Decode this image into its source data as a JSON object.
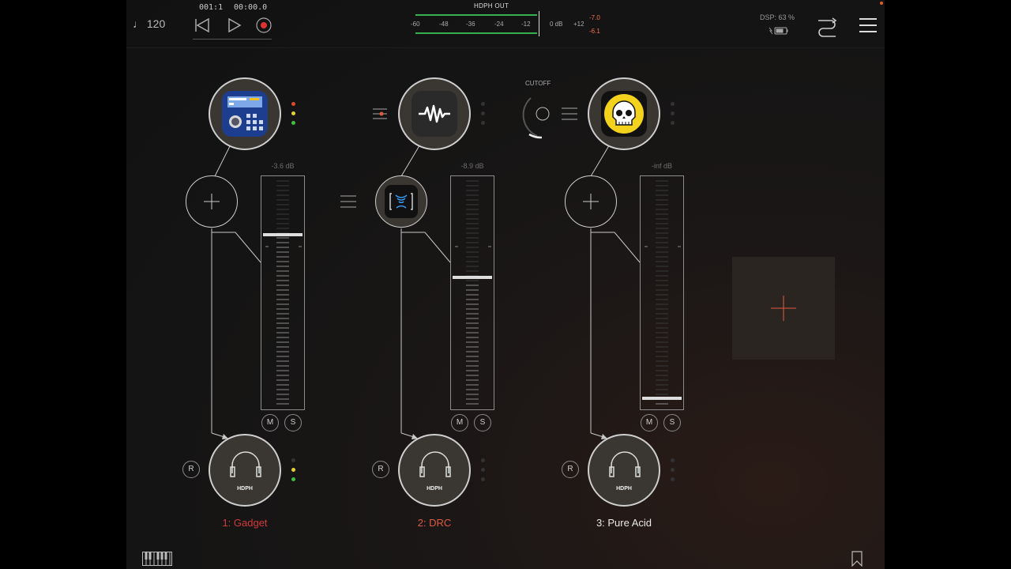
{
  "transport": {
    "tempo": "♩ 120",
    "bar_beat": "001:1",
    "time": "00:00.0"
  },
  "output_meter": {
    "title": "HDPH OUT",
    "scale": [
      "-60",
      "-48",
      "-36",
      "-24",
      "-12",
      "0 dB",
      "+12"
    ],
    "peak_left": "-7.0",
    "peak_right": "-6.1"
  },
  "status": {
    "dsp": "DSP: 63 %"
  },
  "cutoff": {
    "label": "CUTOFF"
  },
  "channels": [
    {
      "name": "1: Gadget",
      "name_color": "#d23a3a",
      "db": "-3.6 dB",
      "fader": 0.76,
      "mute": "M",
      "solo": "S",
      "record": "R",
      "output": "HDPH"
    },
    {
      "name": "2: DRC",
      "name_color": "#e05a3e",
      "db": "-8.9 dB",
      "fader": 0.56,
      "mute": "M",
      "solo": "S",
      "record": "R",
      "output": "HDPH"
    },
    {
      "name": "3: Pure Acid",
      "name_color": "#e8e8e8",
      "db": "-inf dB",
      "fader": 0.0,
      "mute": "M",
      "solo": "S",
      "record": "R",
      "output": "HDPH"
    }
  ],
  "colors": {
    "accent": "#e05a3e",
    "meter_green": "#36b050",
    "panel": "#2b2522"
  }
}
